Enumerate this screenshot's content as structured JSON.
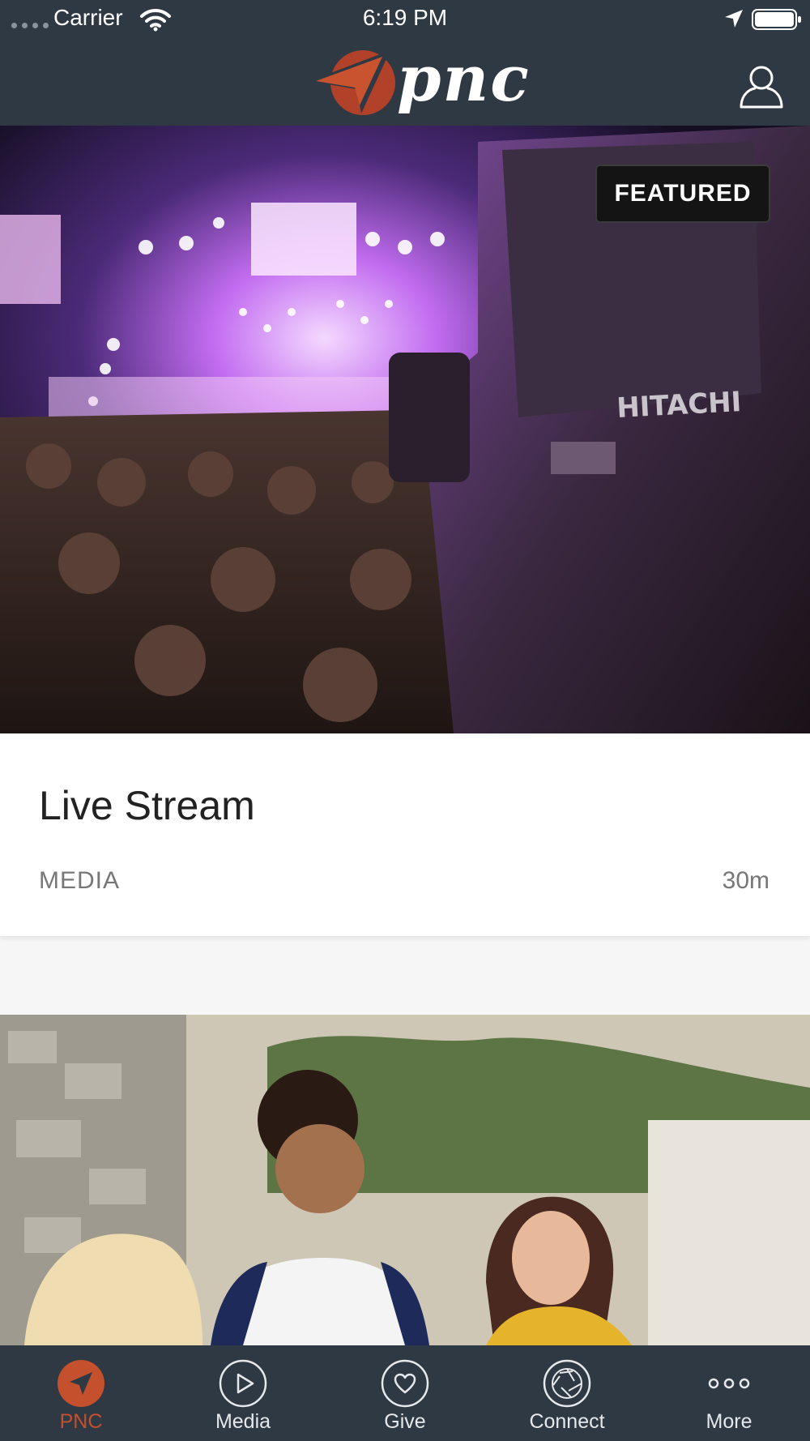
{
  "status_bar": {
    "carrier": "Carrier",
    "time": "6:19 PM"
  },
  "header": {
    "logo_text": "pnc"
  },
  "featured_card": {
    "badge": "FEATURED",
    "title": "Live Stream",
    "category": "MEDIA",
    "duration": "30m"
  },
  "tabs": [
    {
      "label": "PNC",
      "icon": "navigation-arrow-icon",
      "active": true
    },
    {
      "label": "Media",
      "icon": "play-circle-icon",
      "active": false
    },
    {
      "label": "Give",
      "icon": "heart-circle-icon",
      "active": false
    },
    {
      "label": "Connect",
      "icon": "aperture-circle-icon",
      "active": false
    },
    {
      "label": "More",
      "icon": "more-dots-icon",
      "active": false
    }
  ],
  "colors": {
    "header_bg": "#2e3944",
    "accent": "#c4502d",
    "card_bg": "#ffffff",
    "page_bg": "#f6f6f6"
  }
}
